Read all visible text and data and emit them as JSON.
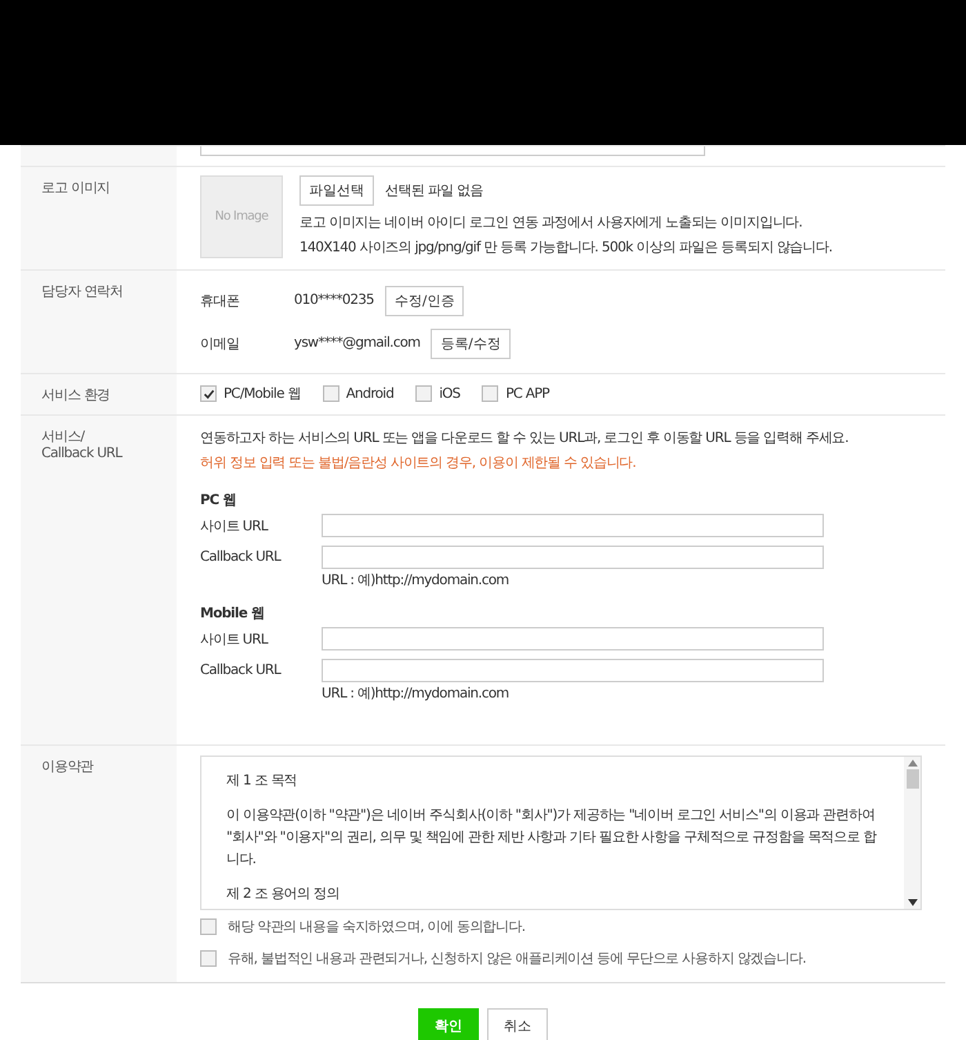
{
  "logo_image": {
    "label": "로고 이미지",
    "preview": "No Image",
    "file_button": "파일선택",
    "file_status": "선택된 파일 없음",
    "help": [
      "로고 이미지는 네이버 아이디 로그인 연동 과정에서 사용자에게 노출되는 이미지입니다.",
      "140X140 사이즈의 jpg/png/gif 만 등록 가능합니다. 500k 이상의 파일은 등록되지 않습니다."
    ]
  },
  "contact": {
    "label": "담당자 연락처",
    "items": [
      {
        "name": "휴대폰",
        "value": "010****0235",
        "button": "수정/인증"
      },
      {
        "name": "이메일",
        "value": "ysw****@gmail.com",
        "button": "등록/수정"
      }
    ]
  },
  "environment": {
    "label": "서비스 환경",
    "options": [
      {
        "label": "PC/Mobile 웹",
        "checked": true
      },
      {
        "label": "Android",
        "checked": false
      },
      {
        "label": "iOS",
        "checked": false
      },
      {
        "label": "PC APP",
        "checked": false
      }
    ]
  },
  "service_url": {
    "label": [
      "서비스/",
      "Callback URL"
    ],
    "description": "연동하고자 하는 서비스의 URL 또는 앱을 다운로드 할 수 있는 URL과, 로그인 후 이동할 URL 등을 입력해 주세요.",
    "warning": "허위 정보 입력 또는 불법/음란성 사이트의 경우, 이용이 제한될 수 있습니다.",
    "groups": [
      {
        "title": "PC 웹",
        "fields": [
          {
            "label": "사이트 URL"
          },
          {
            "label": "Callback URL",
            "hint": "URL : 예)http://mydomain.com"
          }
        ]
      },
      {
        "title": "Mobile 웹",
        "fields": [
          {
            "label": "사이트 URL"
          },
          {
            "label": "Callback URL",
            "hint": "URL : 예)http://mydomain.com"
          }
        ]
      }
    ]
  },
  "terms": {
    "label": "이용약관",
    "paragraphs": [
      "제 1 조 목적",
      "이 이용약관(이하 \"약관\")은 네이버 주식회사(이하 \"회사\")가 제공하는 \"네이버 로그인 서비스\"의 이용과 관련하여 \"회사\"와 \"이용자\"의 권리, 의무 및 책임에 관한 제반 사항과 기타 필요한 사항을 구체적으로 규정함을 목적으로 합니다.",
      "제 2 조 용어의 정의"
    ],
    "agreements": [
      {
        "label": "해당 약관의 내용을 숙지하였으며, 이에 동의합니다.",
        "checked": false
      },
      {
        "label": "유해, 불법적인 내용과 관련되거나, 신청하지 않은 애플리케이션 등에 무단으로 사용하지 않겠습니다.",
        "checked": false
      }
    ]
  },
  "buttons": [
    {
      "label": "확인",
      "kind": "primary"
    },
    {
      "label": "취소",
      "kind": "secondary"
    }
  ]
}
